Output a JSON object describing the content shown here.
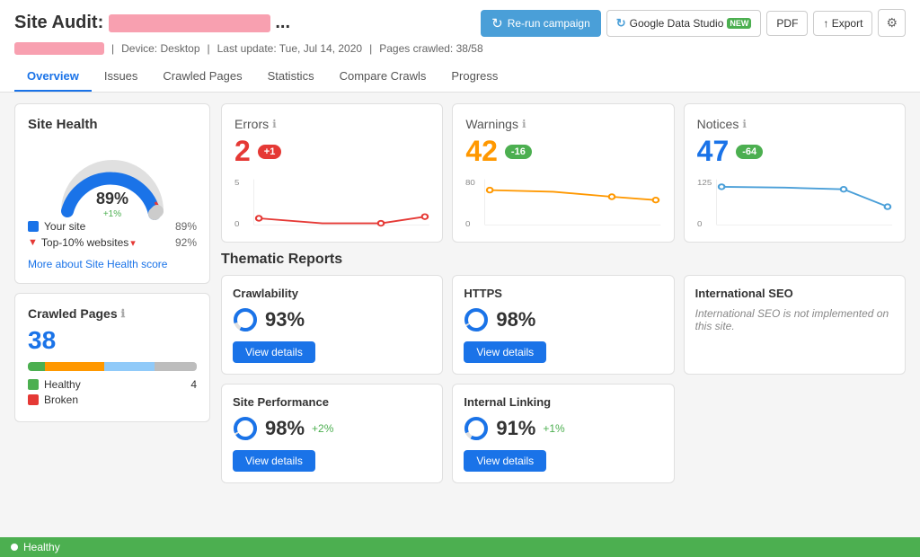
{
  "header": {
    "title_prefix": "Site Audit:",
    "title_suffix": "...",
    "meta": {
      "device": "Device: Desktop",
      "last_update": "Last update: Tue, Jul 14, 2020",
      "pages_crawled": "Pages crawled: 38/58"
    },
    "buttons": {
      "rerun": "Re-run campaign",
      "google": "Google Data Studio",
      "google_badge": "NEW",
      "pdf": "PDF",
      "export": "Export"
    },
    "tabs": [
      "Overview",
      "Issues",
      "Crawled Pages",
      "Statistics",
      "Compare Crawls",
      "Progress"
    ],
    "active_tab": "Overview"
  },
  "site_health": {
    "title": "Site Health",
    "percent": "89%",
    "delta": "+1%",
    "legend": [
      {
        "label": "Your site",
        "color": "#1a73e8",
        "value": "89%",
        "shape": "square"
      },
      {
        "label": "Top-10% websites",
        "color": "#e53935",
        "value": "92%",
        "shape": "arrow"
      }
    ],
    "more_link": "More about Site Health score"
  },
  "crawled_pages": {
    "title": "Crawled Pages",
    "count": "38",
    "legend": [
      {
        "label": "Healthy",
        "color": "#4caf50",
        "value": "4"
      },
      {
        "label": "Broken",
        "color": "#e53935",
        "value": ""
      }
    ]
  },
  "stats": [
    {
      "label": "Errors",
      "value": "2",
      "type": "errors",
      "badge": "+1",
      "badge_type": "pos",
      "chart_color": "#e53935",
      "y_max": "5",
      "y_min": "0",
      "points": [
        [
          0,
          10
        ],
        [
          70,
          60
        ],
        [
          140,
          60
        ],
        [
          200,
          55
        ]
      ]
    },
    {
      "label": "Warnings",
      "value": "42",
      "type": "warnings",
      "badge": "-16",
      "badge_type": "neg",
      "chart_color": "#ff9800",
      "y_max": "80",
      "y_min": "0",
      "points": [
        [
          0,
          20
        ],
        [
          70,
          22
        ],
        [
          140,
          28
        ],
        [
          200,
          32
        ]
      ]
    },
    {
      "label": "Notices",
      "value": "47",
      "type": "notices",
      "badge": "-64",
      "badge_type": "neg",
      "chart_color": "#4a9fd8",
      "y_max": "125",
      "y_min": "0",
      "points": [
        [
          0,
          15
        ],
        [
          70,
          16
        ],
        [
          140,
          18
        ],
        [
          200,
          35
        ]
      ]
    }
  ],
  "thematic_reports": {
    "title": "Thematic Reports",
    "reports": [
      {
        "title": "Crawlability",
        "score": "93%",
        "delta": "",
        "has_button": true,
        "note": ""
      },
      {
        "title": "HTTPS",
        "score": "98%",
        "delta": "",
        "has_button": true,
        "note": ""
      },
      {
        "title": "International SEO",
        "score": "",
        "delta": "",
        "has_button": false,
        "note": "International SEO is not implemented on this site."
      },
      {
        "title": "Site Performance",
        "score": "98%",
        "delta": "+2%",
        "has_button": true,
        "note": ""
      },
      {
        "title": "Internal Linking",
        "score": "91%",
        "delta": "+1%",
        "has_button": true,
        "note": ""
      }
    ]
  },
  "status_bar": {
    "label": "Healthy"
  },
  "icons": {
    "info": "ℹ",
    "settings": "⚙",
    "rerun": "↻",
    "export": "↑",
    "google": "G"
  }
}
